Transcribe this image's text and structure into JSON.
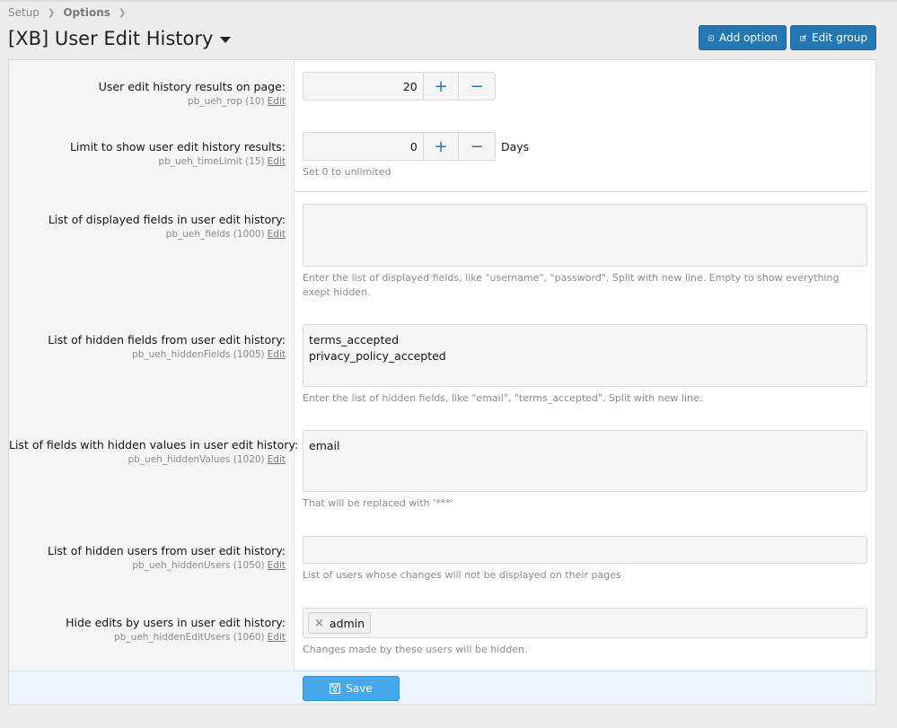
{
  "breadcrumb": [
    {
      "label": "Setup"
    },
    {
      "label": "Options"
    }
  ],
  "page_title": "[XB] User Edit History",
  "header_buttons": {
    "add_option": "Add option",
    "edit_group": "Edit group"
  },
  "edit_link": "Edit",
  "options": {
    "results_on_page": {
      "label": "User edit history results on page:",
      "hint": "pb_ueh_rop (10)",
      "value": "20",
      "plus": "+",
      "minus": "−"
    },
    "time_limit": {
      "label": "Limit to show user edit history results:",
      "hint": "pb_ueh_timeLimit (15)",
      "value": "0",
      "plus": "+",
      "minus": "−",
      "unit": "Days",
      "explain": "Set 0 to unlimited"
    },
    "displayed_fields": {
      "label": "List of displayed fields in user edit history:",
      "hint": "pb_ueh_fields (1000)",
      "value": "",
      "explain": "Enter the list of displayed fields, like \"username\", \"password\". Split with new line. Empty to show everything exept hidden."
    },
    "hidden_fields": {
      "label": "List of hidden fields from user edit history:",
      "hint": "pb_ueh_hiddenFields (1005)",
      "value": "terms_accepted\nprivacy_policy_accepted",
      "explain": "Enter the list of hidden fields, like \"email\", \"terms_accepted\". Split with new line."
    },
    "hidden_values": {
      "label": "List of fields with hidden values in user edit history:",
      "hint": "pb_ueh_hiddenValues (1020)",
      "value": "email",
      "explain": "That will be replaced with '***'"
    },
    "hidden_users": {
      "label": "List of hidden users from user edit history:",
      "hint": "pb_ueh_hiddenUsers (1050)",
      "value": "",
      "explain": "List of users whose changes will not be displayed on their pages"
    },
    "hidden_edit_users": {
      "label": "Hide edits by users in user edit history:",
      "hint": "pb_ueh_hiddenEditUsers (1060)",
      "token_remove": "×",
      "token": "admin",
      "explain": "Changes made by these users will be hidden."
    }
  },
  "save_label": "Save",
  "colors": {
    "primary": "#2577b1",
    "save": "#47a7eb",
    "footer_bg": "#edf6fd"
  }
}
